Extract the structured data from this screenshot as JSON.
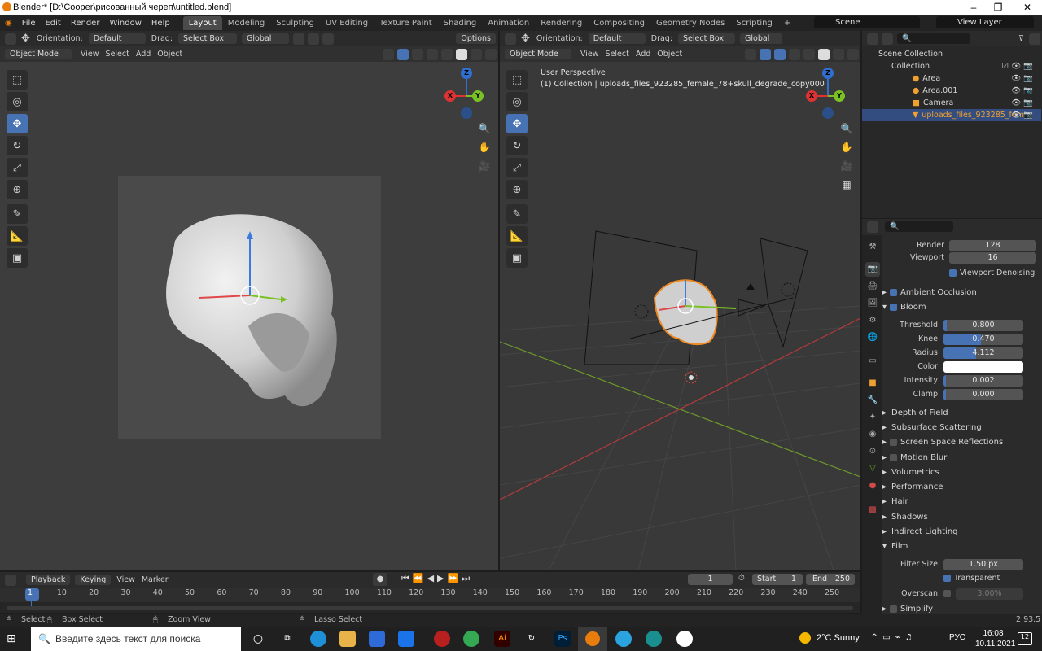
{
  "window": {
    "title": "Blender* [D:\\Cooper\\рисованный череп\\untitled.blend]"
  },
  "menu": [
    "File",
    "Edit",
    "Render",
    "Window",
    "Help"
  ],
  "workspaces": [
    "Layout",
    "Modeling",
    "Sculpting",
    "UV Editing",
    "Texture Paint",
    "Shading",
    "Animation",
    "Rendering",
    "Compositing",
    "Geometry Nodes",
    "Scripting"
  ],
  "active_workspace": "Layout",
  "scene": "Scene",
  "view_layer": "View Layer",
  "viewport_left": {
    "orientation_label": "Orientation:",
    "orientation": "Default",
    "drag_label": "Drag:",
    "drag": "Select Box",
    "transform": "Global",
    "options": "Options",
    "mode": "Object Mode",
    "menus": [
      "View",
      "Select",
      "Add",
      "Object"
    ]
  },
  "viewport_right": {
    "orientation_label": "Orientation:",
    "orientation": "Default",
    "drag_label": "Drag:",
    "drag": "Select Box",
    "transform": "Global",
    "mode": "Object Mode",
    "menus": [
      "View",
      "Select",
      "Add",
      "Object"
    ],
    "perspective": "User Perspective",
    "collection_info": "(1) Collection | uploads_files_923285_female_78+skull_degrade_copy000"
  },
  "gizmo_axes": {
    "z": "Z",
    "y": "Y",
    "x": "X"
  },
  "outliner": {
    "root": "Scene Collection",
    "collection": "Collection",
    "items": [
      "Area",
      "Area.001",
      "Camera",
      "uploads_files_923285_fem"
    ]
  },
  "properties": {
    "samples": [
      {
        "label": "Render",
        "value": "128"
      },
      {
        "label": "Viewport",
        "value": "16"
      }
    ],
    "viewport_denoising": "Viewport Denoising",
    "ambient_occlusion": "Ambient Occlusion",
    "bloom": "Bloom",
    "bloom_fields": [
      {
        "label": "Threshold",
        "value": "0.800",
        "fill": 0.04
      },
      {
        "label": "Knee",
        "value": "0.470",
        "fill": 0.47
      },
      {
        "label": "Radius",
        "value": "4.112",
        "fill": 0.41
      },
      {
        "label": "Color",
        "value": ""
      },
      {
        "label": "Intensity",
        "value": "0.002",
        "fill": 0.01
      },
      {
        "label": "Clamp",
        "value": "0.000",
        "fill": 0.0
      }
    ],
    "sections": [
      "Depth of Field",
      "Subsurface Scattering",
      "Screen Space Reflections",
      "Motion Blur",
      "Volumetrics",
      "Performance",
      "Hair",
      "Shadows",
      "Indirect Lighting",
      "Film"
    ],
    "film": {
      "filter_label": "Filter Size",
      "filter_value": "1.50 px",
      "transparent": "Transparent",
      "overscan_label": "Overscan",
      "overscan_value": "3.00%"
    },
    "simplify": "Simplify"
  },
  "timeline": {
    "menus": [
      "Playback",
      "Keying",
      "View",
      "Marker"
    ],
    "current_frame": "1",
    "start_label": "Start",
    "start": "1",
    "end_label": "End",
    "end": "250",
    "ticks": [
      "1",
      "10",
      "20",
      "30",
      "40",
      "50",
      "60",
      "70",
      "80",
      "90",
      "100",
      "110",
      "120",
      "130",
      "140",
      "150",
      "160",
      "170",
      "180",
      "190",
      "200",
      "210",
      "220",
      "230",
      "240",
      "250"
    ]
  },
  "status": {
    "select": "Select",
    "box_select": "Box Select",
    "zoom": "Zoom View",
    "lasso": "Lasso Select",
    "version": "2.93.5"
  },
  "taskbar": {
    "search": "Введите здесь текст для поиска",
    "weather": "2°C  Sunny",
    "lang": "РУС",
    "time": "16:08",
    "date": "10.11.2021",
    "notif": "12"
  }
}
